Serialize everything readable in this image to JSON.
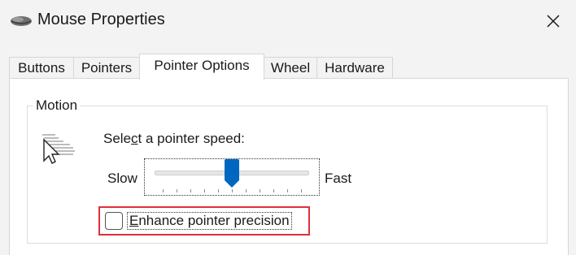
{
  "window": {
    "title": "Mouse Properties"
  },
  "tabs": [
    {
      "label": "Buttons",
      "active": false
    },
    {
      "label": "Pointers",
      "active": false
    },
    {
      "label": "Pointer Options",
      "active": true
    },
    {
      "label": "Wheel",
      "active": false
    },
    {
      "label": "Hardware",
      "active": false
    }
  ],
  "motion": {
    "group_title": "Motion",
    "speed_label_pre": "Sele",
    "speed_label_mnemonic": "c",
    "speed_label_post": "t a pointer speed:",
    "slow_label": "Slow",
    "fast_label": "Fast",
    "speed_fraction": 0.5,
    "tick_count": 11,
    "enhance_precision_mnemonic": "E",
    "enhance_precision_rest": "nhance pointer precision",
    "enhance_precision_checked": false
  },
  "colors": {
    "accent": "#0067c0",
    "highlight_border": "#e0303a"
  },
  "icons": {
    "title": "mouse-icon",
    "close": "close-icon",
    "motion": "pointer-motion-icon"
  }
}
